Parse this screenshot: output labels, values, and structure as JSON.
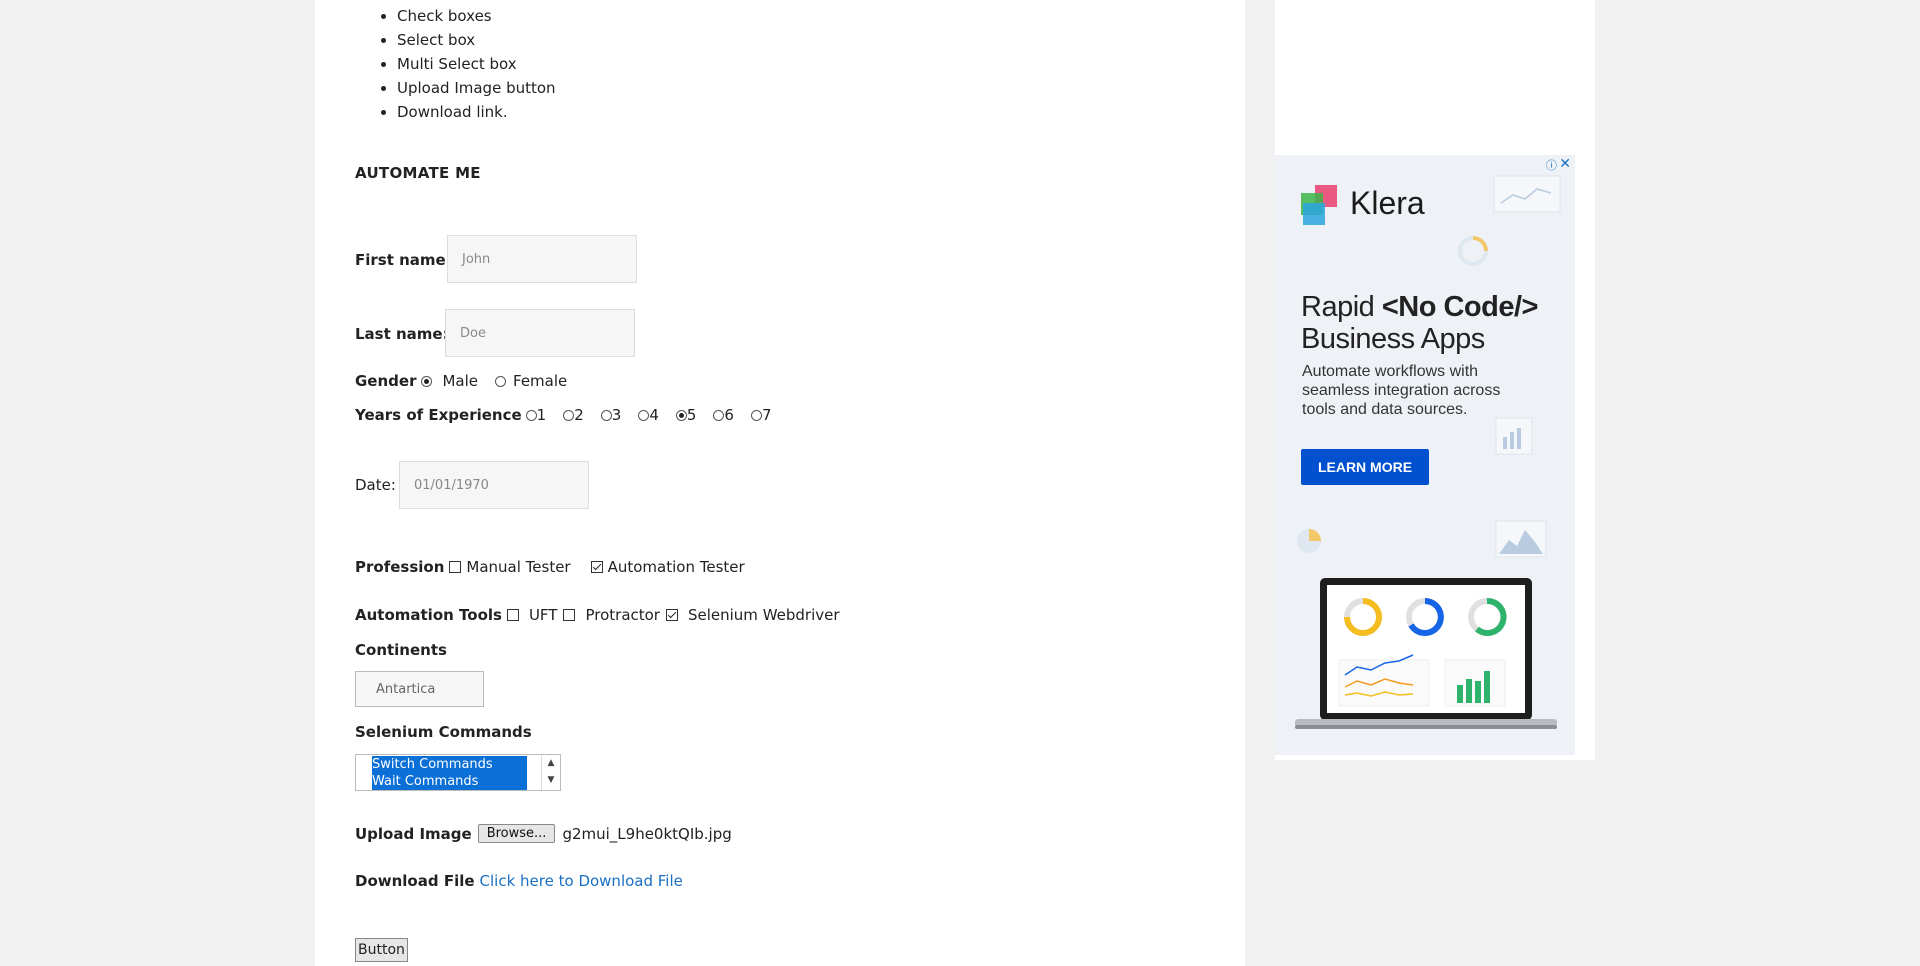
{
  "features": [
    "Check boxes",
    "Select box",
    "Multi Select box",
    "Upload Image button",
    "Download link."
  ],
  "heading": "AUTOMATE ME",
  "first_name": {
    "label": "First name:",
    "placeholder": "John"
  },
  "last_name": {
    "label": "Last name:",
    "placeholder": "Doe"
  },
  "gender": {
    "label": "Gender",
    "options": [
      "Male",
      "Female"
    ],
    "selected": "Male"
  },
  "experience": {
    "label": "Years of Experience",
    "options": [
      "1",
      "2",
      "3",
      "4",
      "5",
      "6",
      "7"
    ],
    "selected": "5"
  },
  "date": {
    "label": "Date:",
    "placeholder": "01/01/1970"
  },
  "profession": {
    "label": "Profession",
    "options": [
      {
        "label": "Manual Tester",
        "checked": false
      },
      {
        "label": "Automation Tester",
        "checked": true
      }
    ]
  },
  "tools": {
    "label": "Automation Tools",
    "options": [
      {
        "label": "UFT",
        "checked": false
      },
      {
        "label": "Protractor",
        "checked": false
      },
      {
        "label": "Selenium Webdriver",
        "checked": true
      }
    ]
  },
  "continents": {
    "label": "Continents",
    "selected": "Antartica"
  },
  "commands": {
    "label": "Selenium Commands",
    "visible_options": [
      "Switch Commands",
      "Wait Commands"
    ]
  },
  "upload": {
    "label": "Upload Image",
    "browse": "Browse...",
    "filename": "g2mui_L9he0ktQIb.jpg"
  },
  "download": {
    "label": "Download File",
    "link": "Click here to Download File"
  },
  "button_label": "Button",
  "ad": {
    "brand": "Klera",
    "headline_1": "Rapid",
    "headline_code": "<No Code/>",
    "headline_2": "Business Apps",
    "sub": "Automate workflows with seamless integration across tools and data sources.",
    "cta": "LEARN MORE",
    "close": "✕",
    "info": "ⓘ",
    "colors": {
      "cta": "#0050d0",
      "brand_pink": "#e83e6c",
      "brand_green": "#3cb54a",
      "brand_blue": "#2aa6df"
    }
  }
}
